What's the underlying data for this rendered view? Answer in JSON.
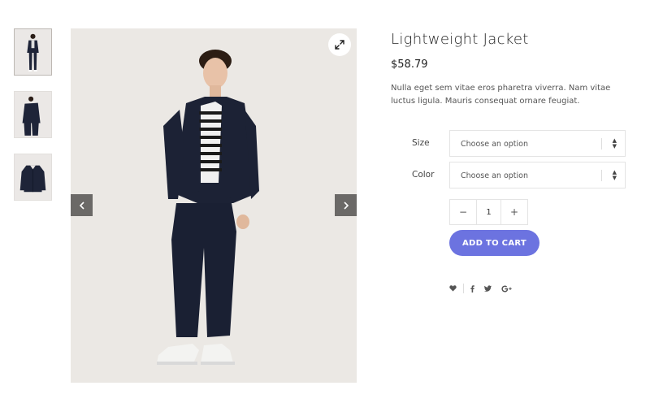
{
  "product": {
    "title": "Lightweight Jacket",
    "price": "$58.79",
    "description": "Nulla eget sem vitae eros pharetra viverra. Nam vitae luctus ligula. Mauris consequat ornare feugiat."
  },
  "options": {
    "size": {
      "label": "Size",
      "value": "Choose an option"
    },
    "color": {
      "label": "Color",
      "value": "Choose an option"
    }
  },
  "quantity": {
    "minus": "−",
    "value": "1",
    "plus": "+"
  },
  "cart": {
    "label": "ADD TO CART",
    "color": "#6c73e0"
  },
  "share": {
    "icons": [
      "heart-icon",
      "facebook-icon",
      "twitter-icon",
      "google-plus-icon"
    ]
  },
  "gallery": {
    "thumbnails": [
      "front-view",
      "back-view",
      "jacket-only"
    ],
    "active_index": 0
  }
}
